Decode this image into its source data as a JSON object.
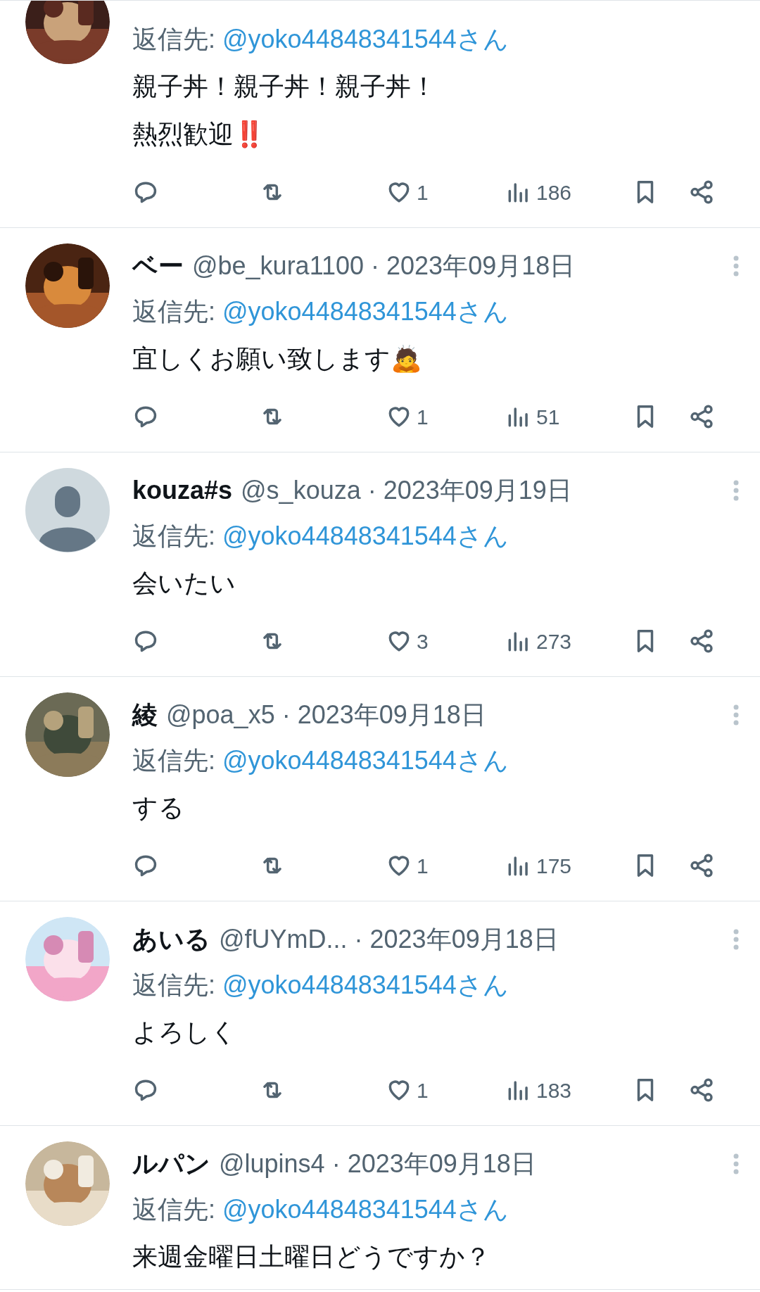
{
  "tweets": [
    {
      "avatar": {
        "kind": "picture"
      },
      "reply_to": {
        "prefix": "返信先:",
        "handle": "@yoko44848341544さん"
      },
      "body": [
        "親子丼！親子丼！親子丼！",
        "熱烈歓迎‼️"
      ],
      "actions": {
        "likes": "1",
        "views": "186"
      }
    },
    {
      "avatar": {
        "kind": "picture"
      },
      "name": "ベー",
      "handle": "@be_kura1100",
      "date": "· 2023年09月18日",
      "reply_to": {
        "prefix": "返信先:",
        "handle": "@yoko44848341544さん"
      },
      "body": [
        "宜しくお願い致します🙇"
      ],
      "actions": {
        "likes": "1",
        "views": "51"
      }
    },
    {
      "avatar": {
        "kind": "default"
      },
      "name": "kouza#s",
      "handle": "@s_kouza",
      "date": "· 2023年09月19日",
      "reply_to": {
        "prefix": "返信先:",
        "handle": "@yoko44848341544さん"
      },
      "body": [
        "会いたい"
      ],
      "actions": {
        "likes": "3",
        "views": "273"
      }
    },
    {
      "avatar": {
        "kind": "picture"
      },
      "name": "綾",
      "handle": "@poa_x5",
      "date": "· 2023年09月18日",
      "reply_to": {
        "prefix": "返信先:",
        "handle": "@yoko44848341544さん"
      },
      "body": [
        "する"
      ],
      "actions": {
        "likes": "1",
        "views": "175"
      }
    },
    {
      "avatar": {
        "kind": "picture"
      },
      "name": "あいる",
      "handle": "@fUYmD...",
      "date": "· 2023年09月18日",
      "reply_to": {
        "prefix": "返信先:",
        "handle": "@yoko44848341544さん"
      },
      "body": [
        "よろしく"
      ],
      "actions": {
        "likes": "1",
        "views": "183"
      }
    },
    {
      "avatar": {
        "kind": "picture"
      },
      "name": "ルパン",
      "handle": "@lupins4",
      "date": "· 2023年09月18日",
      "reply_to": {
        "prefix": "返信先:",
        "handle": "@yoko44848341544さん"
      },
      "body": [
        "来週金曜日土曜日どうですか？"
      ]
    }
  ]
}
